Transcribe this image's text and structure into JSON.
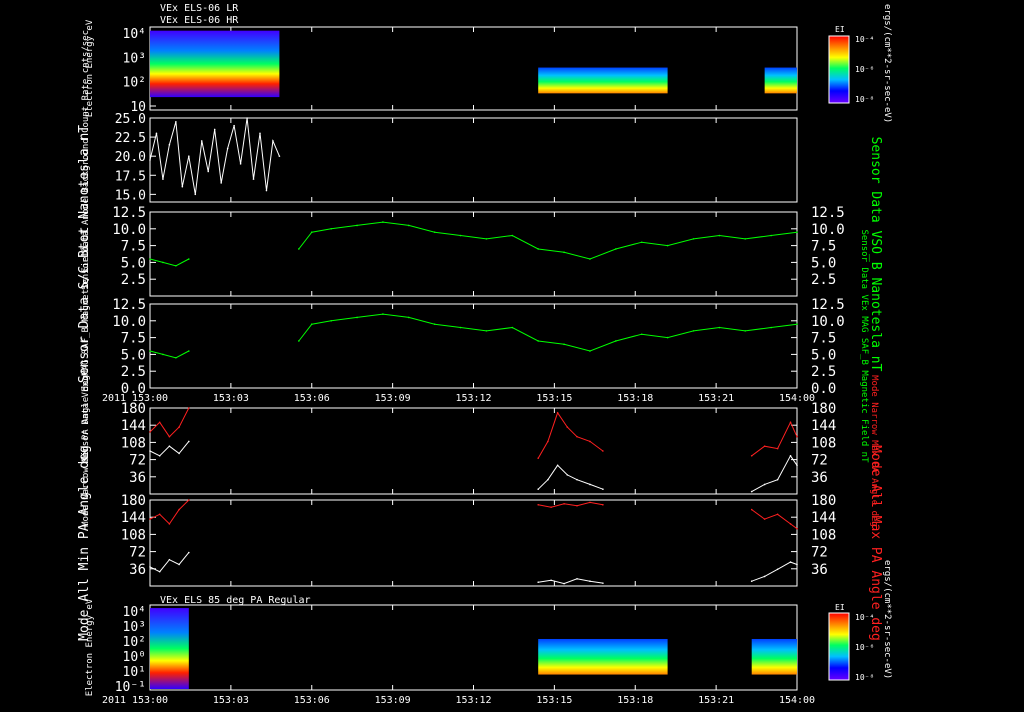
{
  "header": {
    "line1": "VEx ELS-06 LR",
    "line2": "VEx ELS-06 HR"
  },
  "colors": {
    "background": "#000000",
    "axis": "#ffffff",
    "white_trace": "#ffffff",
    "green_trace": "#00ff00",
    "red_trace": "#ff2020"
  },
  "time_axis": {
    "ticks": [
      "153:00",
      "153:03",
      "153:06",
      "153:09",
      "153:12",
      "153:15",
      "153:18",
      "153:21",
      "154:00"
    ],
    "year_label": "2011"
  },
  "chart_data": [
    {
      "id": "els-lr-hr",
      "type": "heatmap",
      "title": "",
      "ylabel": "Electron Energy",
      "yunit": "eV",
      "yscale": "log",
      "yticks": [
        "10⁴",
        "10³",
        "10²",
        "10"
      ],
      "colorbar": {
        "label": "EI",
        "unit": "ergs/(cm**2-sr-sec-eV)",
        "ticks": [
          "10⁻⁴",
          "10⁻⁶",
          "10⁻⁸"
        ]
      },
      "blocks": [
        {
          "t_start": 0.0,
          "t_end": 2.0,
          "e_low": 5,
          "e_high": 20000,
          "level": "high"
        },
        {
          "t_start": 6.0,
          "t_end": 8.0,
          "e_low": 8,
          "e_high": 200,
          "level": "medium"
        },
        {
          "t_start": 9.5,
          "t_end": 10.0,
          "e_low": 8,
          "e_high": 200,
          "level": "medium"
        }
      ]
    },
    {
      "id": "anode-background",
      "type": "line",
      "ylabel": "Sensor Data Anode Background Count Rate",
      "yunit": "cnts/sec",
      "ylim": [
        14,
        25
      ],
      "yticks": [
        "25.0",
        "22.5",
        "20.0",
        "17.5",
        "15.0"
      ],
      "series": [
        {
          "color": "#ffffff",
          "t": [
            0.0,
            0.1,
            0.2,
            0.3,
            0.4,
            0.5,
            0.6,
            0.7,
            0.8,
            0.9,
            1.0,
            1.1,
            1.2,
            1.3,
            1.4,
            1.5,
            1.6,
            1.7,
            1.8,
            1.9,
            2.0
          ],
          "values": [
            19.5,
            23.0,
            17.0,
            21.5,
            24.5,
            16.0,
            20.0,
            15.0,
            22.0,
            18.0,
            23.5,
            16.5,
            21.0,
            24.0,
            19.0,
            25.0,
            17.0,
            23.0,
            15.5,
            22.0,
            20.0
          ]
        }
      ]
    },
    {
      "id": "sc-btot",
      "type": "line",
      "ylabel": "Sensor Data S/C Btot Nanotesla nT",
      "ylabel_right": "Sensor Data VSO_B Nanotesla nT",
      "ylim": [
        0,
        12.5
      ],
      "yticks": [
        "12.5",
        "10.0",
        "7.5",
        "5.0",
        "2.5"
      ],
      "series": [
        {
          "color": "#00ff00",
          "t": [
            0.0,
            0.2,
            0.4,
            0.6,
            2.3,
            2.5,
            2.8,
            3.2,
            3.6,
            4.0,
            4.4,
            4.8,
            5.2,
            5.6,
            6.0,
            6.4,
            6.8,
            7.2,
            7.6,
            8.0,
            8.4,
            8.8,
            9.2,
            9.6,
            10.0
          ],
          "values": [
            5.5,
            5.0,
            4.5,
            5.5,
            7.0,
            9.5,
            10.0,
            10.5,
            11.0,
            10.5,
            9.5,
            9.0,
            8.5,
            9.0,
            7.0,
            6.5,
            5.5,
            7.0,
            8.0,
            7.5,
            8.5,
            9.0,
            8.5,
            9.0,
            9.5
          ]
        }
      ]
    },
    {
      "id": "mag-saf-b",
      "type": "line",
      "ylabel": "Sensor Data VEx MAG SAF_B Magnetic Field nT",
      "ylabel_right": "Sensor Data VEx MAG SAF_B Magnetic Field nT",
      "ylim": [
        0,
        12.5
      ],
      "yticks": [
        "12.5",
        "10.0",
        "7.5",
        "5.0",
        "2.5",
        "0.0"
      ],
      "series": [
        {
          "color": "#00ff00",
          "t": [
            0.0,
            0.2,
            0.4,
            0.6,
            2.3,
            2.5,
            2.8,
            3.2,
            3.6,
            4.0,
            4.4,
            4.8,
            5.2,
            5.6,
            6.0,
            6.4,
            6.8,
            7.2,
            7.6,
            8.0,
            8.4,
            8.8,
            9.2,
            9.6,
            10.0
          ],
          "values": [
            5.5,
            5.0,
            4.5,
            5.5,
            7.0,
            9.5,
            10.0,
            10.5,
            11.0,
            10.5,
            9.5,
            9.0,
            8.5,
            9.0,
            7.0,
            6.5,
            5.5,
            7.0,
            8.0,
            7.5,
            8.5,
            9.0,
            8.5,
            9.0,
            9.5
          ]
        }
      ]
    },
    {
      "id": "narrow-pa",
      "type": "line",
      "ylabel": "Mode Narrow Min PA Angle deg",
      "ylabel_right": "Mode Narrow Max PA Angle deg",
      "ylim": [
        0,
        180
      ],
      "yticks": [
        "180",
        "144",
        "108",
        "72",
        "36"
      ],
      "series": [
        {
          "color": "#ff2020",
          "t": [
            0.0,
            0.15,
            0.3,
            0.45,
            0.6,
            6.0,
            6.15,
            6.3,
            6.45,
            6.6,
            6.8,
            7.0,
            9.3,
            9.5,
            9.7,
            9.9,
            10.0
          ],
          "values": [
            130,
            150,
            120,
            140,
            180,
            75,
            110,
            170,
            140,
            120,
            110,
            90,
            80,
            100,
            95,
            150,
            120
          ]
        },
        {
          "color": "#ffffff",
          "t": [
            0.0,
            0.15,
            0.3,
            0.45,
            0.6,
            6.0,
            6.15,
            6.3,
            6.45,
            6.6,
            6.8,
            7.0,
            9.3,
            9.5,
            9.7,
            9.9,
            10.0
          ],
          "values": [
            90,
            80,
            100,
            85,
            110,
            10,
            30,
            60,
            40,
            30,
            20,
            10,
            5,
            20,
            30,
            80,
            60
          ]
        }
      ]
    },
    {
      "id": "all-pa",
      "type": "line",
      "ylabel": "Mode All Min PA Angle deg",
      "ylabel_right": "Mode All Max PA Angle deg",
      "ylim": [
        0,
        180
      ],
      "yticks": [
        "180",
        "144",
        "108",
        "72",
        "36"
      ],
      "series": [
        {
          "color": "#ff2020",
          "t": [
            0.0,
            0.15,
            0.3,
            0.45,
            0.6,
            6.0,
            6.2,
            6.4,
            6.6,
            6.8,
            7.0,
            9.3,
            9.5,
            9.7,
            9.9,
            10.0
          ],
          "values": [
            140,
            150,
            130,
            160,
            180,
            170,
            165,
            172,
            168,
            175,
            170,
            160,
            140,
            150,
            130,
            120
          ]
        },
        {
          "color": "#ffffff",
          "t": [
            0.0,
            0.15,
            0.3,
            0.45,
            0.6,
            6.0,
            6.2,
            6.4,
            6.6,
            6.8,
            7.0,
            9.3,
            9.5,
            9.7,
            9.9,
            10.0
          ],
          "values": [
            40,
            30,
            55,
            45,
            70,
            8,
            12,
            5,
            15,
            10,
            6,
            10,
            20,
            35,
            50,
            45
          ]
        }
      ]
    },
    {
      "id": "els-85deg",
      "type": "heatmap",
      "title": "VEx ELS 85 deg PA Regular",
      "ylabel": "Electron Energy",
      "yunit": "eV",
      "yscale": "log",
      "yticks": [
        "10⁴",
        "10³",
        "10²",
        "10⁰",
        "10¹",
        "10⁻¹"
      ],
      "colorbar": {
        "label": "EI",
        "unit": "ergs/(cm**2-sr-sec-eV)",
        "ticks": [
          "10⁻⁴",
          "10⁻⁶",
          "10⁻⁸"
        ]
      },
      "blocks": [
        {
          "t_start": 0.0,
          "t_end": 0.6,
          "e_low": 0.1,
          "e_high": 20000,
          "level": "high"
        },
        {
          "t_start": 6.0,
          "t_end": 8.0,
          "e_low": 1,
          "e_high": 200,
          "level": "medium"
        },
        {
          "t_start": 9.3,
          "t_end": 10.0,
          "e_low": 1,
          "e_high": 200,
          "level": "medium"
        }
      ]
    }
  ]
}
